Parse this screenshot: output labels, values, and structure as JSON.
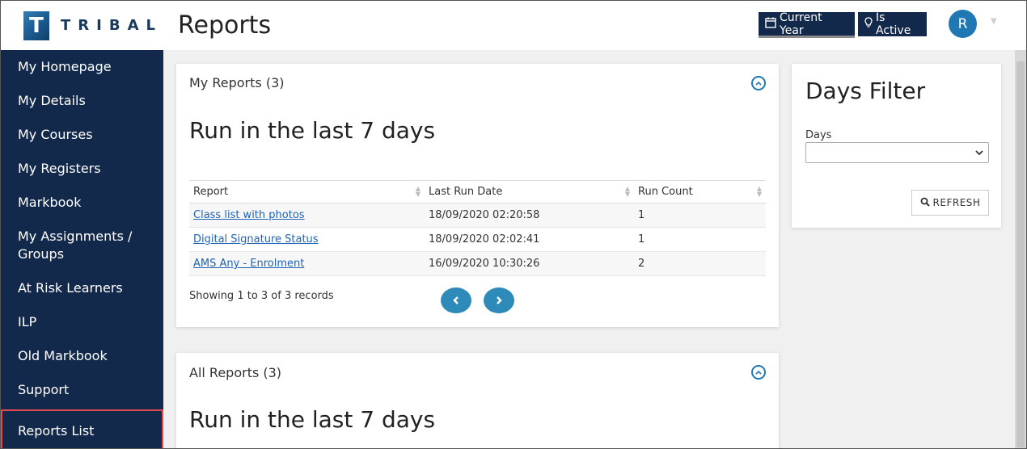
{
  "header": {
    "logo_letter": "T",
    "logo_text": "TRIBAL",
    "page_title": "Reports",
    "current_year_label": "Current Year",
    "is_active_label": "Is Active",
    "avatar_initial": "R"
  },
  "sidebar": {
    "items": [
      {
        "label": "My Homepage"
      },
      {
        "label": "My Details"
      },
      {
        "label": "My Courses"
      },
      {
        "label": "My Registers"
      },
      {
        "label": "Markbook"
      },
      {
        "label": "My Assignments /"
      },
      {
        "label": "Groups"
      },
      {
        "label": "At Risk Learners"
      },
      {
        "label": "ILP"
      },
      {
        "label": "Old Markbook"
      },
      {
        "label": "Support"
      },
      {
        "label": "Reports List"
      }
    ],
    "selected": "Reports List"
  },
  "my_reports": {
    "title": "My Reports (3)",
    "heading": "Run in the last 7 days",
    "columns": [
      "Report",
      "Last Run Date",
      "Run Count"
    ],
    "rows": [
      {
        "report": "Class list with photos",
        "last_run": "18/09/2020 02:20:58",
        "count": "1"
      },
      {
        "report": "Digital Signature Status",
        "last_run": "18/09/2020 02:02:41",
        "count": "1"
      },
      {
        "report": "AMS Any - Enrolment",
        "last_run": "16/09/2020 10:30:26",
        "count": "2"
      }
    ],
    "showing": "Showing 1 to 3 of 3 records"
  },
  "all_reports": {
    "title": "All Reports (3)",
    "heading": "Run in the last 7 days"
  },
  "days_filter": {
    "title": "Days Filter",
    "label": "Days",
    "value": "",
    "refresh_label": "REFRESH"
  },
  "colors": {
    "navy": "#13294b",
    "accent_blue": "#1f78b4",
    "link": "#1f63b4",
    "selected_border": "#e5484d"
  }
}
